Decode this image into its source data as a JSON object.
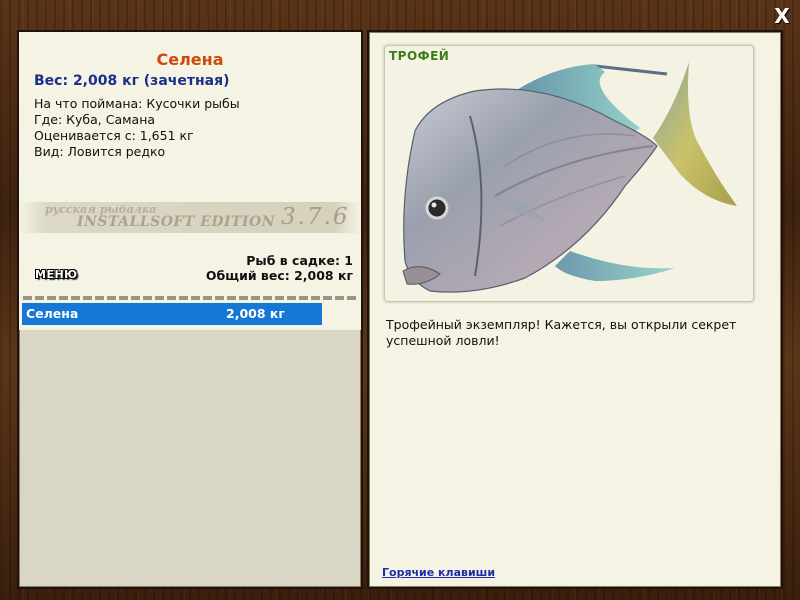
{
  "window": {
    "close_glyph": "X"
  },
  "fish": {
    "name": "Селена",
    "weight_line": "Вес: 2,008 кг (зачетная)",
    "caught_on": "На что поймана: Кусочки рыбы",
    "where": "Где: Куба, Самана",
    "valued_from": "Оценивается с: 1,651 кг",
    "kind": "Вид: Ловится редко"
  },
  "logo": {
    "small_text": "русская рыбалка",
    "main_text": "INSTALLSOFT EDITION",
    "version": "3.7.6"
  },
  "menu": {
    "label": "МЕНЮ"
  },
  "cage": {
    "count_line": "Рыб в садке: 1",
    "total_line": "Общий вес: 2,008 кг"
  },
  "catch_list": [
    {
      "name": "Селена",
      "weight": "2,008 кг"
    }
  ],
  "trophy": {
    "badge": "ТРОФЕЙ",
    "description": "Трофейный экземпляр! Кажется, вы открыли секрет успешной ловли!"
  },
  "footer": {
    "hotkeys_link": "Горячие клавиши"
  },
  "colors": {
    "name_accent": "#cc4a10",
    "weight_blue": "#1a2e8c",
    "selection_blue": "#1577d6",
    "trophy_green": "#3e7a1b",
    "panel_bg": "#f5f3e3"
  }
}
